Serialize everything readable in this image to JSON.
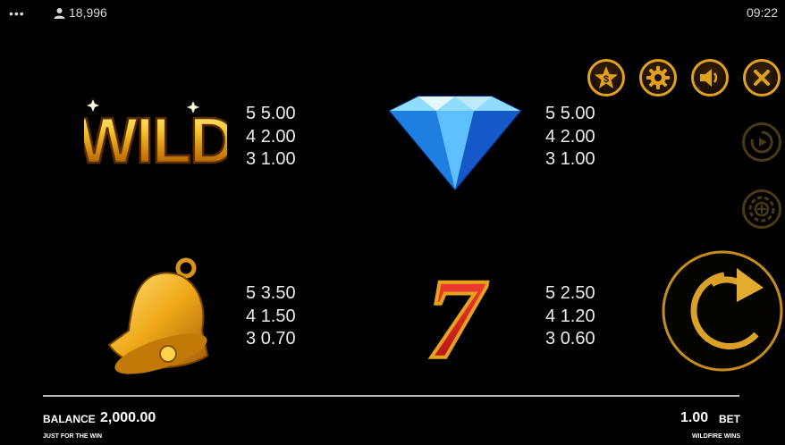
{
  "status_bar": {
    "menu_dots": "•••",
    "player_count": "18,996",
    "time": "09:22"
  },
  "paytable": [
    {
      "symbol": "wild-symbol",
      "wild_text": "WILD",
      "payouts": [
        {
          "count": "5",
          "value": "5.00"
        },
        {
          "count": "4",
          "value": "2.00"
        },
        {
          "count": "3",
          "value": "1.00"
        }
      ]
    },
    {
      "symbol": "diamond-symbol",
      "payouts": [
        {
          "count": "5",
          "value": "5.00"
        },
        {
          "count": "4",
          "value": "2.00"
        },
        {
          "count": "3",
          "value": "1.00"
        }
      ]
    },
    {
      "symbol": "bell-symbol",
      "payouts": [
        {
          "count": "5",
          "value": "3.50"
        },
        {
          "count": "4",
          "value": "1.50"
        },
        {
          "count": "3",
          "value": "0.70"
        }
      ]
    },
    {
      "symbol": "seven-symbol",
      "seven_text": "7",
      "payouts": [
        {
          "count": "5",
          "value": "2.50"
        },
        {
          "count": "4",
          "value": "1.20"
        },
        {
          "count": "3",
          "value": "0.60"
        }
      ]
    }
  ],
  "controls": {
    "coin_symbol": "$"
  },
  "footer": {
    "balance_label": "BALANCE",
    "balance_value": "2,000.00",
    "left_caption": "JUST FOR THE WIN",
    "bet_value": "1.00",
    "bet_label": "BET",
    "right_caption": "WILDFIRE WINS"
  },
  "colors": {
    "gold": "#e0a11c",
    "background": "#000000",
    "divider": "#bdbdbd"
  }
}
